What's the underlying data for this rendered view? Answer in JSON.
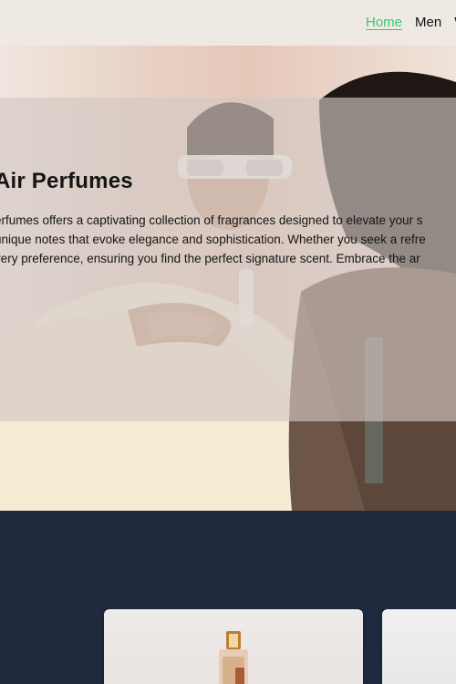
{
  "nav": {
    "items": [
      {
        "label": "Home",
        "active": true
      },
      {
        "label": "Men",
        "active": false
      },
      {
        "label": "W",
        "active": false
      }
    ],
    "active_color": "#2ecc71"
  },
  "hero": {
    "title": "Air Perfumes",
    "description_lines": [
      "erfumes offers a captivating collection of fragrances designed to elevate your s",
      "unique notes that evoke elegance and sophistication. Whether you seek a refre",
      "very preference, ensuring you find the perfect signature scent. Embrace the ar"
    ]
  },
  "colors": {
    "nav_bg": "#efe9e4",
    "section_bg": "#1f2a3f"
  }
}
